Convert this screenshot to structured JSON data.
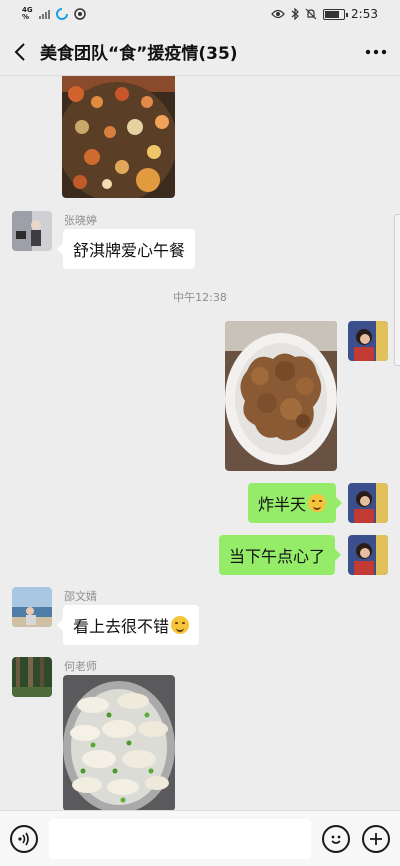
{
  "status_bar": {
    "network": "4G",
    "network_sub": "%",
    "time": "2:53"
  },
  "header": {
    "title": "美食团队“食”援疫情(35)"
  },
  "messages": [
    {
      "type": "image",
      "side": "in",
      "description": "soup photo"
    },
    {
      "type": "text",
      "side": "in",
      "sender": "张晓婷",
      "text": "舒淇牌爱心午餐"
    },
    {
      "type": "time",
      "text": "中午12:38"
    },
    {
      "type": "image",
      "side": "out"
    },
    {
      "type": "text",
      "side": "out",
      "text": "炸半天",
      "emoji": "grin-sweat"
    },
    {
      "type": "text",
      "side": "out",
      "text": "当下午点心了"
    },
    {
      "type": "text",
      "side": "in",
      "sender": "邵文婧",
      "text": "看上去很不错",
      "emoji": "thinking"
    },
    {
      "type": "image",
      "side": "in",
      "sender": "何老师"
    }
  ],
  "input_bar": {
    "placeholder": ""
  },
  "colors": {
    "chat_bg": "#ededed",
    "out_bubble": "#95ec69",
    "in_bubble": "#ffffff"
  }
}
